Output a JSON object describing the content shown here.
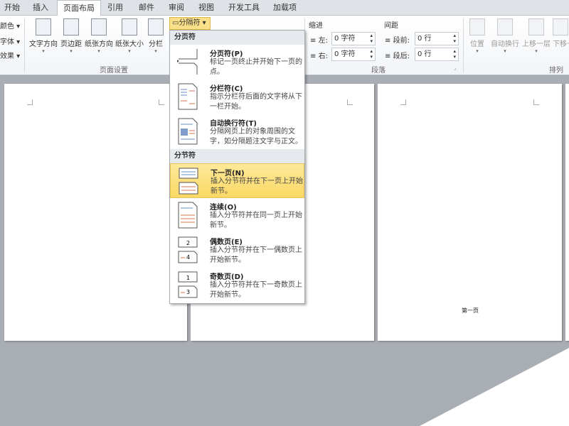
{
  "tabs": [
    "开始",
    "插入",
    "页面布局",
    "引用",
    "邮件",
    "审阅",
    "视图",
    "开发工具",
    "加载项"
  ],
  "active_tab": "页面布局",
  "theme_items": [
    "颜色",
    "字体",
    "效果"
  ],
  "page_setup": {
    "buttons": [
      "文字方向",
      "页边距",
      "纸张方向",
      "纸张大小",
      "分栏"
    ],
    "breaks_button": "分隔符",
    "label": "页面设置"
  },
  "paragraph": {
    "indent_label": "缩进",
    "left_label": "左:",
    "left_value": "0 字符",
    "right_label": "右:",
    "right_value": "0 字符",
    "spacing_label": "间距",
    "before_label": "段前:",
    "before_value": "0 行",
    "after_label": "段后:",
    "after_value": "0 行",
    "label": "段落"
  },
  "arrange": {
    "buttons": [
      "位置",
      "自动换行",
      "上移一层",
      "下移一层"
    ],
    "label": "排列"
  },
  "menu": {
    "page_breaks_header": "分页符",
    "page_breaks": [
      {
        "title": "分页符(P)",
        "desc": "标记一页终止并开始下一页的点。"
      },
      {
        "title": "分栏符(C)",
        "desc": "指示分栏符后面的文字将从下一栏开始。"
      },
      {
        "title": "自动换行符(T)",
        "desc": "分隔网页上的对象周围的文字，如分隔题注文字与正文。"
      }
    ],
    "section_breaks_header": "分节符",
    "section_breaks": [
      {
        "title": "下一页(N)",
        "desc": "插入分节符并在下一页上开始新节。",
        "highlighted": true
      },
      {
        "title": "连续(O)",
        "desc": "插入分节符并在同一页上开始新节。"
      },
      {
        "title": "偶数页(E)",
        "desc": "插入分节符并在下一偶数页上开始新节。"
      },
      {
        "title": "奇数页(D)",
        "desc": "插入分节符并在下一奇数页上开始新节。"
      }
    ]
  },
  "document": {
    "page3_text": "第一页"
  },
  "colors": {
    "highlight": "#fbd865",
    "workspace": "#a9adb4"
  }
}
